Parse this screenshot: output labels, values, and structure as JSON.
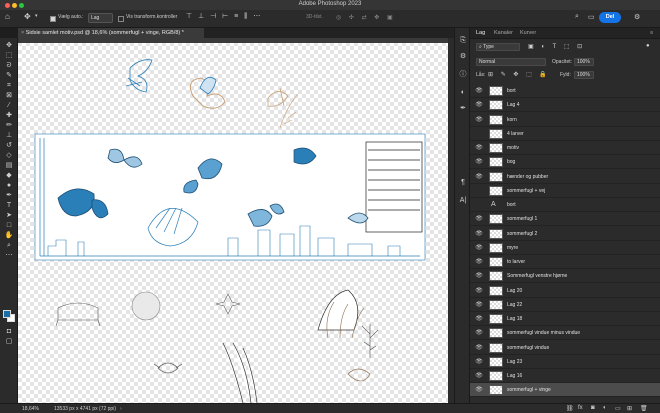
{
  "app": {
    "title": "Adobe Photoshop 2023",
    "share_label": "Del"
  },
  "options_bar": {
    "autoselect_label": "Vælg auto.:",
    "autoselect_value": "Lag",
    "transform_label": "Vis transform.kontroller",
    "mode_3d": "3D-tilst."
  },
  "document": {
    "tab_title": "Sidsie samlet motiv.psd @ 18,6% (sommerfugl + vinge, RGB/8) *"
  },
  "status": {
    "zoom": "18,64%",
    "dimensions": "13533 px x 4741 px (72 ppi)"
  },
  "layers_panel": {
    "tabs": [
      "Lag",
      "Kanaler",
      "Kurver"
    ],
    "filter_label": "Type",
    "blend_mode": "Normal",
    "opacity_label": "Opacitet:",
    "opacity_value": "100%",
    "lock_label": "Lås:",
    "fill_label": "Fyld:",
    "fill_value": "100%",
    "layers": [
      {
        "name": "bort",
        "kind": "pixel",
        "visible": true
      },
      {
        "name": "Lag 4",
        "kind": "pixel",
        "visible": true
      },
      {
        "name": "korn",
        "kind": "pixel",
        "visible": true
      },
      {
        "name": "4 larver",
        "kind": "pixel",
        "visible": false
      },
      {
        "name": "motiv",
        "kind": "pixel",
        "visible": true
      },
      {
        "name": "bog",
        "kind": "pixel",
        "visible": true
      },
      {
        "name": "hænder og pubber",
        "kind": "pixel",
        "visible": true
      },
      {
        "name": "sommerfugl + vej",
        "kind": "pixel",
        "visible": false
      },
      {
        "name": "bort",
        "kind": "text",
        "visible": false
      },
      {
        "name": "sommerfugl 1",
        "kind": "pixel",
        "visible": true
      },
      {
        "name": "sommerfugl 2",
        "kind": "pixel",
        "visible": true
      },
      {
        "name": "myre",
        "kind": "pixel",
        "visible": true
      },
      {
        "name": "to larver",
        "kind": "pixel",
        "visible": true
      },
      {
        "name": "Sommerfugl venstre hjørne",
        "kind": "pixel",
        "visible": true
      },
      {
        "name": "Lag 20",
        "kind": "pixel",
        "visible": true
      },
      {
        "name": "Lag 22",
        "kind": "pixel",
        "visible": true
      },
      {
        "name": "Lag 18",
        "kind": "pixel",
        "visible": true
      },
      {
        "name": "sommerfugl vindue minus vindue",
        "kind": "pixel",
        "visible": true
      },
      {
        "name": "sommerfugl vindue",
        "kind": "pixel",
        "visible": true
      },
      {
        "name": "Lag 23",
        "kind": "pixel",
        "visible": true
      },
      {
        "name": "Lag 16",
        "kind": "pixel",
        "visible": true
      },
      {
        "name": "sommerfugl + vinge",
        "kind": "pixel",
        "visible": true,
        "selected": true
      }
    ]
  },
  "colors": {
    "accent": "#1473e6",
    "artwork_blue": "#2b7fb8",
    "foreground_swatch": "#1a6fa8"
  }
}
